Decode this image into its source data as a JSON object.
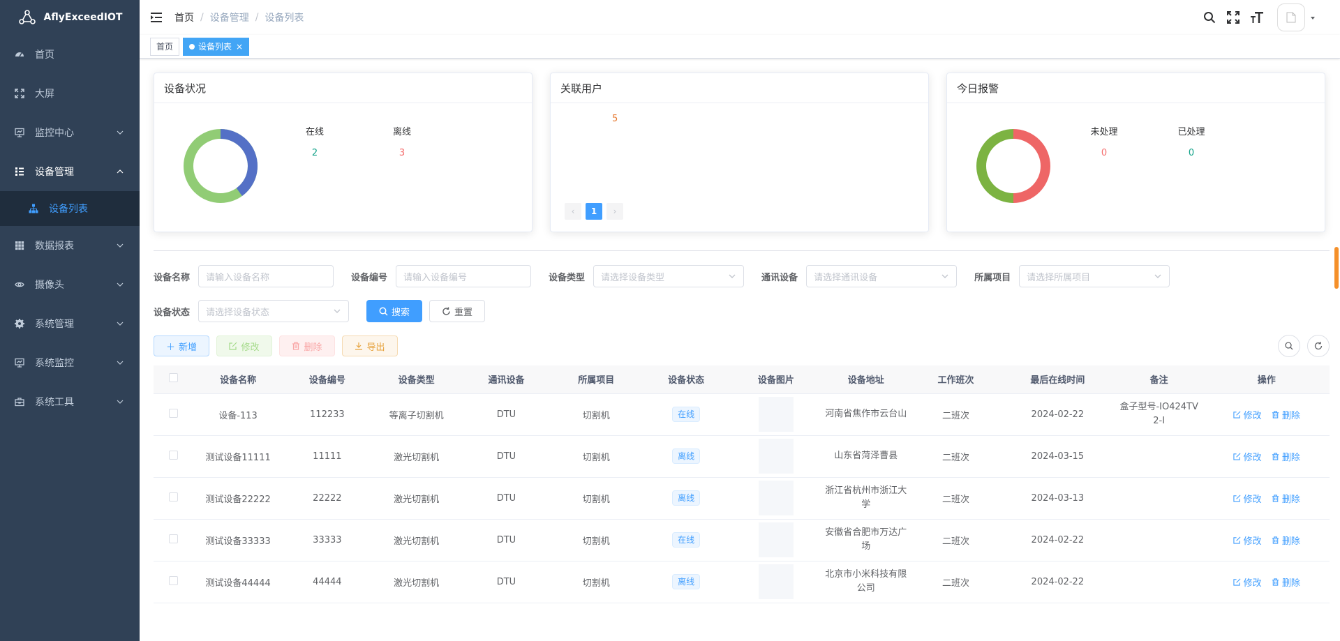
{
  "app": {
    "title": "AflyExceedIOT"
  },
  "sidebar": {
    "items": [
      {
        "label": "首页",
        "icon": "dashboard-icon"
      },
      {
        "label": "大屏",
        "icon": "fullscreen-icon"
      },
      {
        "label": "监控中心",
        "icon": "monitor-icon"
      },
      {
        "label": "设备管理",
        "icon": "list-icon"
      },
      {
        "label": "数据报表",
        "icon": "table-icon"
      },
      {
        "label": "摄像头",
        "icon": "eye-icon"
      },
      {
        "label": "系统管理",
        "icon": "settings-icon"
      },
      {
        "label": "系统监控",
        "icon": "monitor-icon"
      },
      {
        "label": "系统工具",
        "icon": "toolbox-icon"
      }
    ],
    "subitem": {
      "label": "设备列表",
      "icon": "tree-icon"
    }
  },
  "breadcrumb": {
    "home": "首页",
    "level1": "设备管理",
    "level2": "设备列表",
    "sep": "/"
  },
  "tags": {
    "home": "首页",
    "active": "设备列表",
    "close": "×"
  },
  "cards": {
    "status": {
      "title": "设备状况",
      "online_label": "在线",
      "online_value": "2",
      "offline_label": "离线",
      "offline_value": "3",
      "donut": {
        "online": 2,
        "offline": 3,
        "online_color": "#5470c6",
        "offline_color": "#91cc75"
      }
    },
    "users": {
      "title": "关联用户",
      "value": "5",
      "page": "1",
      "prev": "‹",
      "next": "›"
    },
    "alarms": {
      "title": "今日报警",
      "pending_label": "未处理",
      "pending_value": "0",
      "done_label": "已处理",
      "done_value": "0",
      "donut": {
        "colors": [
          "#ee6666",
          "#7cb342"
        ]
      }
    }
  },
  "filters": {
    "name": {
      "label": "设备名称",
      "placeholder": "请输入设备名称"
    },
    "code": {
      "label": "设备编号",
      "placeholder": "请输入设备编号"
    },
    "type": {
      "label": "设备类型",
      "placeholder": "请选择设备类型"
    },
    "comm": {
      "label": "通讯设备",
      "placeholder": "请选择通讯设备"
    },
    "project": {
      "label": "所属项目",
      "placeholder": "请选择所属项目"
    },
    "status": {
      "label": "设备状态",
      "placeholder": "请选择设备状态"
    },
    "search": "搜索",
    "reset": "重置"
  },
  "toolbar": {
    "add": "新增",
    "edit": "修改",
    "delete": "删除",
    "export": "导出"
  },
  "table": {
    "headers": [
      "设备名称",
      "设备编号",
      "设备类型",
      "通讯设备",
      "所属项目",
      "设备状态",
      "设备图片",
      "设备地址",
      "工作班次",
      "最后在线时间",
      "备注",
      "操作"
    ],
    "edit_label": "修改",
    "delete_label": "删除",
    "rows": [
      {
        "name": "设备-113",
        "code": "112233",
        "type": "等离子切割机",
        "comm": "DTU",
        "project": "切割机",
        "status": "在线",
        "addr": "河南省焦作市云台山",
        "shift": "二班次",
        "last": "2024-02-22",
        "remark": "盒子型号-IO424TV2-I"
      },
      {
        "name": "测试设备11111",
        "code": "11111",
        "type": "激光切割机",
        "comm": "DTU",
        "project": "切割机",
        "status": "离线",
        "addr": "山东省菏泽曹县",
        "shift": "二班次",
        "last": "2024-03-15",
        "remark": ""
      },
      {
        "name": "测试设备22222",
        "code": "22222",
        "type": "激光切割机",
        "comm": "DTU",
        "project": "切割机",
        "status": "离线",
        "addr": "浙江省杭州市浙江大学",
        "shift": "二班次",
        "last": "2024-03-13",
        "remark": ""
      },
      {
        "name": "测试设备33333",
        "code": "33333",
        "type": "激光切割机",
        "comm": "DTU",
        "project": "切割机",
        "status": "在线",
        "addr": "安徽省合肥市万达广场",
        "shift": "二班次",
        "last": "2024-02-22",
        "remark": ""
      },
      {
        "name": "测试设备44444",
        "code": "44444",
        "type": "激光切割机",
        "comm": "DTU",
        "project": "切割机",
        "status": "离线",
        "addr": "北京市小米科技有限公司",
        "shift": "二班次",
        "last": "2024-02-22",
        "remark": ""
      }
    ]
  },
  "colors": {
    "primary": "#409eff",
    "sidebar_bg": "#304156",
    "online_text": "#13ce66",
    "offline_text": "#ff4949",
    "users_text": "#e6782e"
  }
}
